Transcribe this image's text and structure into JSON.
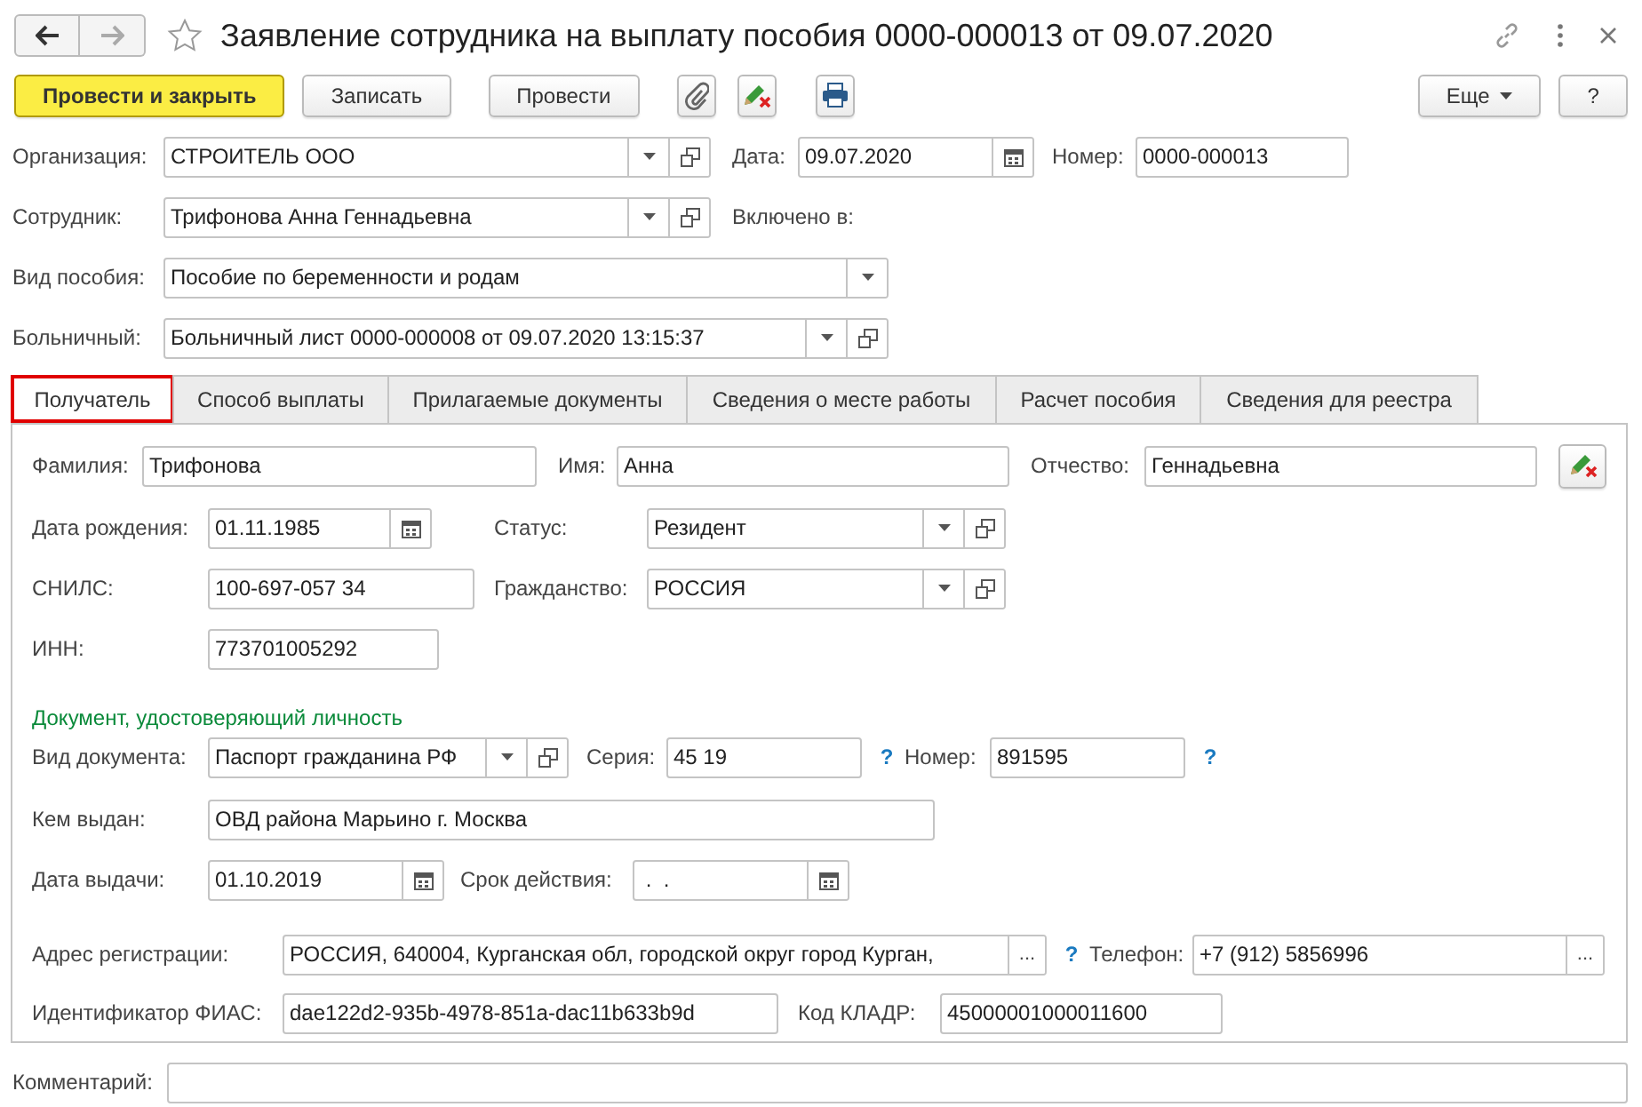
{
  "window": {
    "title": "Заявление сотрудника на выплату пособия 0000-000013 от 09.07.2020",
    "favorite": false
  },
  "toolbar": [
    {
      "kind": "primary",
      "label": "Провести и закрыть"
    },
    {
      "kind": "button",
      "label": "Записать"
    },
    {
      "kind": "button",
      "label": "Провести"
    },
    {
      "kind": "attach"
    },
    {
      "kind": "edit"
    },
    {
      "kind": "print"
    },
    {
      "kind": "more",
      "label": "Еще"
    },
    {
      "kind": "button",
      "label": "?"
    }
  ],
  "header": [
    [
      {
        "label": "Организация:",
        "value": "СТРОИТЕЛЬ ООО",
        "kind": "select"
      },
      {
        "label": "Дата:",
        "value": "09.07.2020",
        "kind": "date"
      },
      {
        "label": "Номер:",
        "value": "0000-000013",
        "kind": "text"
      }
    ],
    [
      {
        "label": "Сотрудник:",
        "value": "Трифонова Анна Геннадьевна",
        "kind": "select"
      },
      {
        "label": "Включено в:",
        "kind": "note"
      }
    ],
    [
      {
        "label": "Вид пособия:",
        "value": "Пособие по беременности и родам",
        "kind": "dropdown"
      }
    ],
    [
      {
        "label": "Больничный:",
        "value": "Больничный лист 0000-000008 от 09.07.2020 13:15:37",
        "kind": "select"
      }
    ]
  ],
  "tabs": [
    {
      "label": "Получатель",
      "selected": true
    },
    {
      "label": "Способ выплаты",
      "selected": false
    },
    {
      "label": "Прилагаемые документы",
      "selected": false
    },
    {
      "label": "Сведения о месте работы",
      "selected": false
    },
    {
      "label": "Расчет пособия",
      "selected": false
    },
    {
      "label": "Сведения для реестра",
      "selected": false
    }
  ],
  "recipient": [
    [
      {
        "label": "Фамилия:",
        "value": "Трифонова",
        "kind": "text"
      },
      {
        "label": "Имя:",
        "value": "Анна",
        "kind": "text"
      },
      {
        "label": "Отчество:",
        "value": "Геннадьевна",
        "kind": "text"
      },
      {
        "kind": "action"
      }
    ],
    [
      {
        "label": "Дата рождения:",
        "value": "01.11.1985",
        "kind": "date"
      },
      {
        "label": "Статус:",
        "value": "Резидент",
        "kind": "select"
      }
    ],
    [
      {
        "label": "СНИЛС:",
        "value": "100-697-057 34",
        "kind": "text"
      },
      {
        "label": "Гражданство:",
        "value": "РОССИЯ",
        "kind": "select"
      }
    ],
    [
      {
        "label": "ИНН:",
        "value": "773701005292",
        "kind": "text"
      }
    ],
    [
      {
        "label": "Документ, удостоверяющий личность",
        "kind": "heading"
      }
    ],
    [
      {
        "label": "Вид документа:",
        "value": "Паспорт гражданина РФ",
        "kind": "select"
      },
      {
        "label": "Серия:",
        "value": "45 19",
        "kind": "text"
      },
      {
        "label": "?",
        "kind": "help"
      },
      {
        "label": "Номер:",
        "value": "891595",
        "kind": "text"
      },
      {
        "label": "?",
        "kind": "help"
      }
    ],
    [
      {
        "label": "Кем выдан:",
        "value": "ОВД района Марьино г. Москва",
        "kind": "text"
      }
    ],
    [
      {
        "label": "Дата выдачи:",
        "value": "01.10.2019",
        "kind": "date"
      },
      {
        "label": "Срок действия:",
        "value": " .  .",
        "kind": "date"
      }
    ],
    [
      {
        "label": "Адрес регистрации:",
        "value": "РОССИЯ, 640004, Курганская обл, городской округ город Курган,",
        "kind": "choice",
        "button": "..."
      },
      {
        "label": "?",
        "kind": "help"
      },
      {
        "label": "Телефон:",
        "value": "+7 (912) 5856996",
        "kind": "choice",
        "button": "..."
      }
    ],
    [
      {
        "label": "Идентификатор ФИАС:",
        "value": "dae122d2-935b-4978-851a-dac11b633b9d",
        "kind": "text"
      },
      {
        "label": "Код КЛАДР:",
        "value": "45000001000011600",
        "kind": "text"
      }
    ]
  ],
  "comment": {
    "label": "Комментарий:"
  }
}
